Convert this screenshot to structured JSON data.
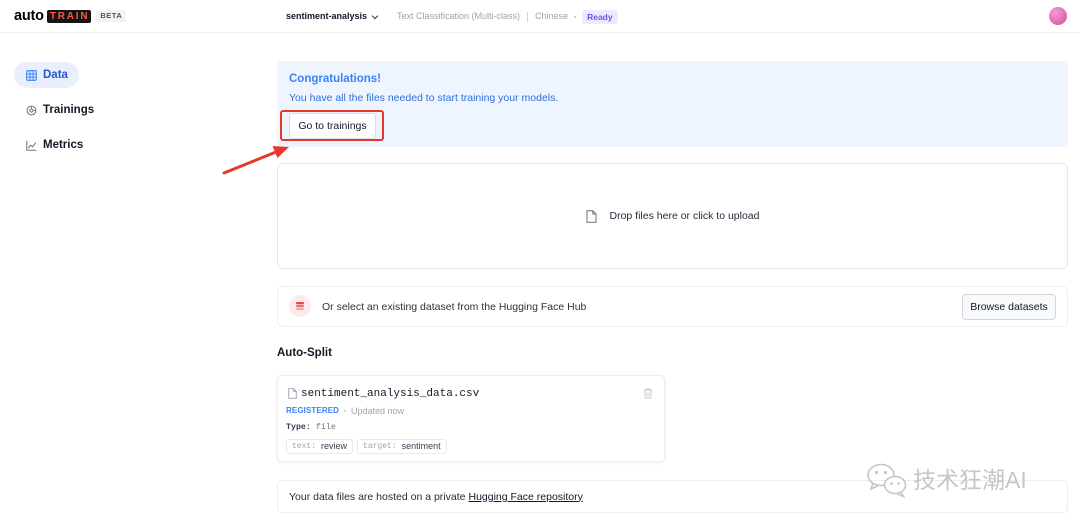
{
  "header": {
    "logo_text": "auto",
    "logo_badge": "TRAIN",
    "beta_label": "BETA",
    "project_name": "sentiment-analysis",
    "project_menu_icon": "chevron-down-icon",
    "task": "Text Classification (Multi-class)",
    "language": "Chinese",
    "status": "Ready"
  },
  "sidebar": {
    "items": [
      {
        "label": "Data",
        "icon": "grid-icon",
        "active": true
      },
      {
        "label": "Trainings",
        "icon": "trainings-icon",
        "active": false
      },
      {
        "label": "Metrics",
        "icon": "chart-icon",
        "active": false
      }
    ]
  },
  "notice": {
    "title": "Congratulations!",
    "message": "You have all the files needed to start training your models.",
    "button_label": "Go to trainings"
  },
  "upload": {
    "icon": "file-icon",
    "label": "Drop files here or click to upload"
  },
  "hub": {
    "icon": "database-icon",
    "label": "Or select an existing dataset from the Hugging Face Hub",
    "button_label": "Browse datasets"
  },
  "auto_split": {
    "heading": "Auto-Split",
    "files": [
      {
        "icon": "file-icon",
        "name": "sentiment_analysis_data.csv",
        "delete_icon": "trash-icon",
        "status": "REGISTERED",
        "updated": "Updated now",
        "type_label": "Type:",
        "type_value": "file",
        "columns": [
          {
            "key": "text:",
            "value": "review"
          },
          {
            "key": "target:",
            "value": "sentiment"
          }
        ]
      }
    ]
  },
  "footer": {
    "text": "Your data files are hosted on a private",
    "link_label": "Hugging Face repository"
  },
  "watermark": {
    "icon": "wechat-icon",
    "text": "技术狂潮AI"
  },
  "colors": {
    "accent": "#3b82f6",
    "annotation_red": "#e5392b",
    "notice_bg": "#eef5fe",
    "status_bg": "#eceafd",
    "status_text": "#6457e6",
    "avatar": "#e06bb4"
  }
}
